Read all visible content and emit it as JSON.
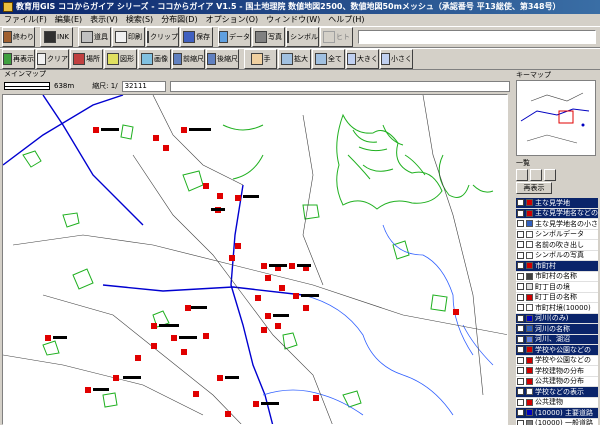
{
  "window": {
    "title": "教育用GIS ココからガイア シリーズ - ココからガイア V1.5 - 国土地理院 数値地図2500、数値地図50mメッシュ（承認番号 平13総使、第348号）"
  },
  "menu": [
    "ファイル(F)",
    "編集(E)",
    "表示(V)",
    "検索(S)",
    "分布図(D)",
    "オプション(O)",
    "ウィンドウ(W)",
    "ヘルプ(H)"
  ],
  "toolbar1": [
    {
      "label": "終わり",
      "icon": "door-icon"
    },
    {
      "label": "INK",
      "icon": "ink-icon"
    },
    {
      "label": "道具",
      "icon": "tools-icon"
    },
    {
      "label": "印刷",
      "icon": "printer-icon"
    },
    {
      "label": "クリップ",
      "icon": "clipboard-icon"
    },
    {
      "label": "保存",
      "icon": "save-icon"
    },
    {
      "label": "データ",
      "icon": "data-icon"
    },
    {
      "label": "写真",
      "icon": "camera-icon"
    },
    {
      "label": "シンボル",
      "icon": "symbol-icon"
    },
    {
      "label": "ヒト",
      "icon": "person-icon"
    }
  ],
  "toolbar2": [
    {
      "label": "再表示",
      "icon": "refresh-icon"
    },
    {
      "label": "クリア",
      "icon": "clear-icon"
    },
    {
      "label": "場所",
      "icon": "place-icon"
    },
    {
      "label": "図形",
      "icon": "shape-icon"
    },
    {
      "label": "画像",
      "icon": "image-icon"
    },
    {
      "label": "前縮尺",
      "icon": "prev-scale-icon"
    },
    {
      "label": "後縮尺",
      "icon": "next-scale-icon"
    },
    {
      "label": "手",
      "icon": "hand-icon"
    },
    {
      "label": "拡大",
      "icon": "zoom-in-area-icon"
    },
    {
      "label": "全て",
      "icon": "full-extent-icon"
    },
    {
      "label": "大きく",
      "icon": "zoom-in-icon"
    },
    {
      "label": "小さく",
      "icon": "zoom-out-icon"
    }
  ],
  "search": {
    "value": ""
  },
  "mainmap": {
    "title": "メインマップ",
    "distance": "638m",
    "scale_label": "縮尺: 1/",
    "scale_value": "32111"
  },
  "keymap": {
    "title": "キーマップ"
  },
  "layerlist": {
    "title": "一覧",
    "refresh_label": "再表示",
    "items": [
      {
        "label": "主な見学地",
        "hl": true,
        "color": "#d00000"
      },
      {
        "label": "主な見学地名などの",
        "hl": true,
        "color": "#d00000"
      },
      {
        "label": "主な見学地名の小さ",
        "hl": false,
        "color": "#3060c0"
      },
      {
        "label": "シンボルデータ",
        "hl": false,
        "color": "#ffffff"
      },
      {
        "label": "名前の吹き出し",
        "hl": false,
        "color": "#ffffff"
      },
      {
        "label": "シンボルの写真",
        "hl": false,
        "color": "#ffffff"
      },
      {
        "label": "市町村",
        "hl": true,
        "color": "#d00000"
      },
      {
        "label": "市町村の名称",
        "hl": false,
        "color": "#404040"
      },
      {
        "label": "町丁目の境",
        "hl": false,
        "color": "#e0e0e0"
      },
      {
        "label": "町丁目の名称",
        "hl": false,
        "color": "#d00000"
      },
      {
        "label": "市町村境(10000)",
        "hl": false,
        "color": "#ffffff"
      },
      {
        "label": "河川(のみ)",
        "hl": true,
        "color": "#0000c0"
      },
      {
        "label": "河川の名称",
        "hl": true,
        "color": "#3060c0"
      },
      {
        "label": "河川、湖沼",
        "hl": true,
        "color": "#6080e0"
      },
      {
        "label": "学校や公園などの",
        "hl": true,
        "color": "#d00000"
      },
      {
        "label": "学校や公園などの",
        "hl": false,
        "color": "#d00000"
      },
      {
        "label": "学校建物の分布",
        "hl": false,
        "color": "#d00000"
      },
      {
        "label": "公共建物の分布",
        "hl": false,
        "color": "#d00000"
      },
      {
        "label": "学校などの表示",
        "hl": true,
        "color": "#ffffff"
      },
      {
        "label": "公共建物",
        "hl": false,
        "color": "#d00000"
      },
      {
        "label": "(10000) 主要道路",
        "hl": true,
        "color": "#0000c0"
      },
      {
        "label": "(10000) 一般道路",
        "hl": false,
        "color": "#808080"
      }
    ]
  }
}
